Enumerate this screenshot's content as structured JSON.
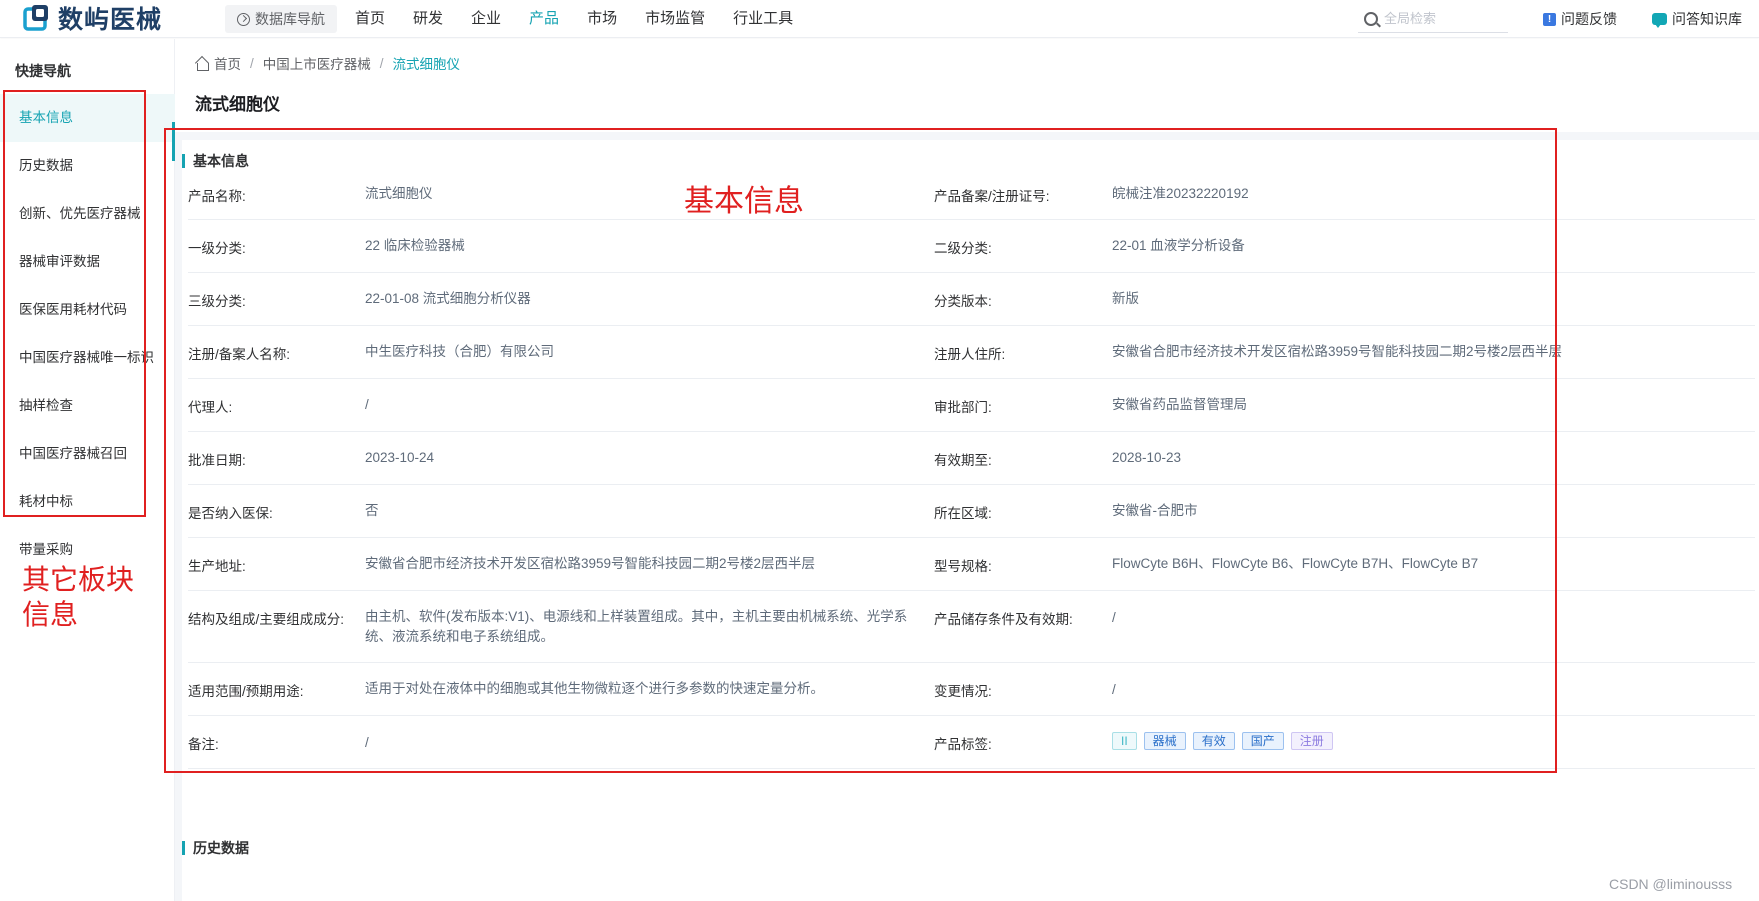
{
  "header": {
    "logo_text": "数屿医械",
    "db_nav_label": "数据库导航",
    "nav": [
      {
        "label": "首页",
        "active": false
      },
      {
        "label": "研发",
        "active": false
      },
      {
        "label": "企业",
        "active": false
      },
      {
        "label": "产品",
        "active": true
      },
      {
        "label": "市场",
        "active": false
      },
      {
        "label": "市场监管",
        "active": false
      },
      {
        "label": "行业工具",
        "active": false
      }
    ],
    "search_placeholder": "全局检索",
    "feedback_label": "问题反馈",
    "knowledge_label": "问答知识库"
  },
  "sidebar": {
    "title": "快捷导航",
    "items": [
      {
        "label": "基本信息",
        "active": true
      },
      {
        "label": "历史数据",
        "active": false
      },
      {
        "label": "创新、优先医疗器械",
        "active": false
      },
      {
        "label": "器械审评数据",
        "active": false
      },
      {
        "label": "医保医用耗材代码",
        "active": false
      },
      {
        "label": "中国医疗器械唯一标识",
        "active": false
      },
      {
        "label": "抽样检查",
        "active": false
      },
      {
        "label": "中国医疗器械召回",
        "active": false
      },
      {
        "label": "耗材中标",
        "active": false
      },
      {
        "label": "带量采购",
        "active": false
      }
    ]
  },
  "breadcrumb": {
    "home": "首页",
    "level2": "中国上市医疗器械",
    "current": "流式细胞仪"
  },
  "page_title": "流式细胞仪",
  "basic_info": {
    "section_title": "基本信息",
    "rows": [
      {
        "label1": "产品名称:",
        "value1": "流式细胞仪",
        "label2": "产品备案/注册证号:",
        "value2": "皖械注准20232220192"
      },
      {
        "label1": "一级分类:",
        "value1": "22 临床检验器械",
        "label2": "二级分类:",
        "value2": "22-01 血液学分析设备"
      },
      {
        "label1": "三级分类:",
        "value1": "22-01-08 流式细胞分析仪器",
        "label2": "分类版本:",
        "value2": "新版"
      },
      {
        "label1": "注册/备案人名称:",
        "value1": "中生医疗科技（合肥）有限公司",
        "label2": "注册人住所:",
        "value2": "安徽省合肥市经济技术开发区宿松路3959号智能科技园二期2号楼2层西半层"
      },
      {
        "label1": "代理人:",
        "value1": "/",
        "label2": "审批部门:",
        "value2": "安徽省药品监督管理局"
      },
      {
        "label1": "批准日期:",
        "value1": "2023-10-24",
        "label2": "有效期至:",
        "value2": "2028-10-23"
      },
      {
        "label1": "是否纳入医保:",
        "value1": "否",
        "label2": "所在区域:",
        "value2": "安徽省-合肥市"
      },
      {
        "label1": "生产地址:",
        "value1": "安徽省合肥市经济技术开发区宿松路3959号智能科技园二期2号楼2层西半层",
        "label2": "型号规格:",
        "value2": "FlowCyte B6H、FlowCyte B6、FlowCyte B7H、FlowCyte B7"
      },
      {
        "label1": "结构及组成/主要组成成分:",
        "value1": "由主机、软件(发布版本:V1)、电源线和上样装置组成。其中，主机主要由机械系统、光学系统、液流系统和电子系统组成。",
        "label2": "产品储存条件及有效期:",
        "value2": "/"
      },
      {
        "label1": "适用范围/预期用途:",
        "value1": "适用于对处在液体中的细胞或其他生物微粒逐个进行多参数的快速定量分析。",
        "label2": "变更情况:",
        "value2": "/"
      },
      {
        "label1": "备注:",
        "value1": "/",
        "label2": "产品标签:",
        "value2": ""
      }
    ],
    "tags": [
      "II",
      "器械",
      "有效",
      "国产",
      "注册"
    ]
  },
  "next_section_title": "历史数据",
  "annotations": {
    "main_label": "基本信息",
    "side_label_line1": "其它板块",
    "side_label_line2": "信息"
  },
  "watermark": "CSDN @liminousss",
  "colors": {
    "accent": "#15a3b2",
    "annotation_red": "#e02020",
    "brand_dark": "#1f3f66"
  }
}
